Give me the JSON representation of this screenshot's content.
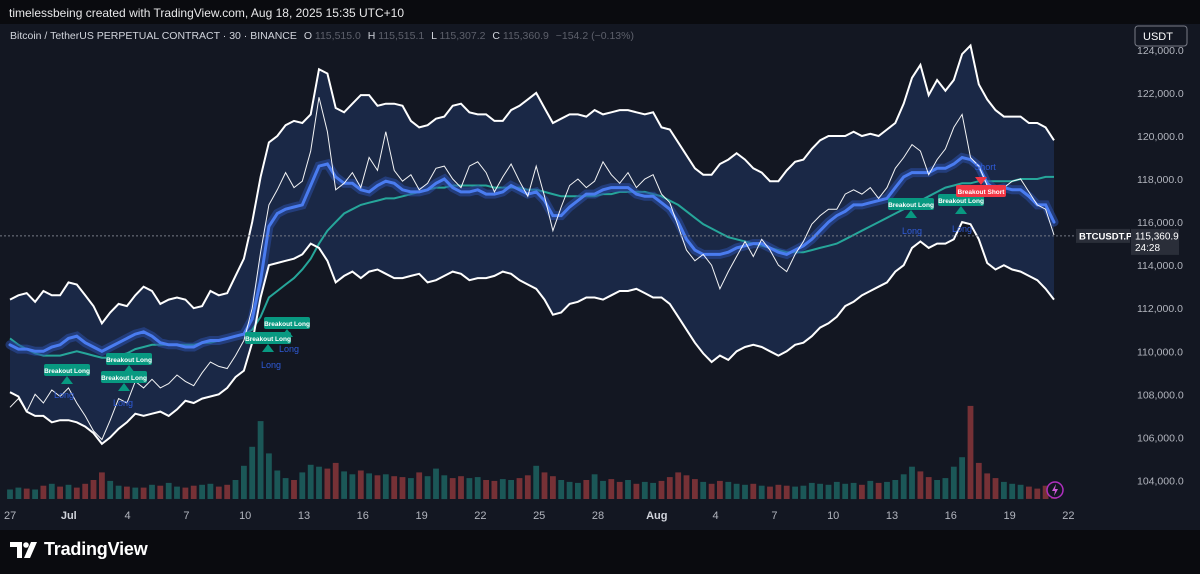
{
  "header": {
    "watermark": "timelessbeing created with TradingView.com, Aug 18, 2025 15:35 UTC+10"
  },
  "legend": {
    "symbol": "Bitcoin / TetherUS PERPETUAL CONTRACT · 30 · BINANCE",
    "o_label": "O",
    "o_value": "115,515.0",
    "h_label": "H",
    "h_value": "115,515.1",
    "l_label": "L",
    "l_value": "115,307.2",
    "c_label": "C",
    "c_value": "115,360.9",
    "change": "−154.2 (−0.13%)"
  },
  "scale": {
    "currency_button": "USDT"
  },
  "price_tag": {
    "ticker": "BTCUSDT.P",
    "price": "115,360.9",
    "countdown": "24:28"
  },
  "signals": [
    {
      "label": "Breakout Long",
      "kind": "long"
    },
    {
      "label": "Breakout Long",
      "kind": "long"
    },
    {
      "label": "Breakout Long",
      "kind": "long"
    },
    {
      "label": "Breakout Long",
      "kind": "long"
    },
    {
      "label": "Breakout Long",
      "kind": "long"
    },
    {
      "label": "Breakout Long",
      "kind": "long"
    },
    {
      "label": "Breakout Long",
      "kind": "long"
    },
    {
      "label": "Breakout Short",
      "kind": "short"
    }
  ],
  "long_markers": [
    "Long",
    "Long",
    "Long",
    "Long",
    "Long",
    "Long"
  ],
  "short_markers": [
    "Short"
  ],
  "footer": {
    "brand": "TradingView"
  },
  "colors": {
    "background": "#131722",
    "band_fill": "#1c2a4a",
    "envelope": "#ffffff",
    "trend_blue": "#4a7cf0",
    "slow_ma": "#26a69a",
    "long_green": "#089981",
    "short_red": "#f23645"
  },
  "chart_data": {
    "type": "line",
    "title": "",
    "ylim": [
      103000,
      125200
    ],
    "y_ticks": [
      104000,
      106000,
      108000,
      110000,
      112000,
      114000,
      116000,
      118000,
      120000,
      122000,
      124000
    ],
    "y_tick_labels": [
      "104,000.0",
      "106,000.0",
      "108,000.0",
      "110,000.0",
      "112,000.0",
      "114,000.0",
      "116,000.0",
      "118,000.0",
      "120,000.0",
      "122,000.0",
      "124,000.0"
    ],
    "x_tick_labels": [
      "27",
      "Jul",
      "4",
      "7",
      "10",
      "13",
      "16",
      "19",
      "22",
      "25",
      "28",
      "Aug",
      "4",
      "7",
      "10",
      "13",
      "16",
      "19",
      "22"
    ],
    "x_tick_bold": [
      false,
      true,
      false,
      false,
      false,
      false,
      false,
      false,
      false,
      false,
      false,
      true,
      false,
      false,
      false,
      false,
      false,
      false,
      false
    ],
    "grid": false,
    "last_price": 115360.9,
    "series": [
      {
        "values": [
          107400,
          107800,
          107200,
          108000,
          107600,
          108200,
          107900,
          108300,
          107600,
          107000,
          106300,
          105900,
          106800,
          107800,
          107600,
          108600,
          108300,
          108700,
          108300,
          108500,
          108900,
          108600,
          108400,
          109000,
          109500,
          109300,
          109200,
          109800,
          110500,
          112000,
          114600,
          116800,
          117500,
          118300,
          117600,
          117900,
          119300,
          121800,
          120200,
          117500,
          117800,
          118300,
          117600,
          119000,
          118400,
          120200,
          118400,
          117900,
          118200,
          117500,
          117800,
          118500,
          118600,
          118000,
          117600,
          118600,
          118800,
          118300,
          117400,
          118100,
          118700,
          117900,
          117200,
          118600,
          117200,
          115600,
          116700,
          117700,
          118000,
          117600,
          117900,
          118800,
          118200,
          117800,
          118300,
          117600,
          118000,
          118200,
          117300,
          116900,
          115800,
          114700,
          114200,
          114500,
          114000,
          112900,
          113700,
          114400,
          115100,
          114400,
          115200,
          114700,
          114000,
          113700,
          114500,
          115100,
          115900,
          116300,
          116600,
          116600,
          117300,
          117500,
          117300,
          117600,
          117100,
          117600,
          118500,
          119000,
          119600,
          119300,
          118200,
          118900,
          119400,
          120400,
          121000,
          119000,
          118600,
          117700,
          117400,
          117600,
          117900,
          118000,
          117400,
          116800,
          116600,
          115400
        ]
      },
      {
        "values": [
          110300,
          110100,
          110100,
          110000,
          110000,
          110200,
          110300,
          110600,
          110700,
          110400,
          110200,
          110000,
          110200,
          110400,
          110600,
          110800,
          110900,
          110700,
          110400,
          110300,
          110300,
          110200,
          110200,
          110400,
          110500,
          110500,
          110600,
          110700,
          110800,
          111500,
          113300,
          115800,
          116400,
          116600,
          116700,
          116800,
          117700,
          118600,
          118700,
          118100,
          117800,
          117800,
          117500,
          117400,
          117700,
          117900,
          117800,
          117500,
          117400,
          117400,
          117500,
          117800,
          118000,
          117600,
          117400,
          117400,
          117500,
          117300,
          117300,
          117400,
          117700,
          117500,
          117300,
          117400,
          117000,
          116300,
          116300,
          116700,
          117000,
          117300,
          117300,
          117500,
          117600,
          117600,
          117600,
          117300,
          117200,
          117200,
          116900,
          116600,
          116000,
          115200,
          114700,
          114500,
          114500,
          114500,
          114600,
          114800,
          114900,
          115000,
          115000,
          114800,
          114600,
          114500,
          114700,
          114900,
          115200,
          115600,
          116000,
          116300,
          116500,
          116800,
          116800,
          116900,
          117000,
          117100,
          117600,
          118100,
          118300,
          118300,
          118300,
          118500,
          118500,
          118700,
          119000,
          118900,
          118600,
          117800,
          117500,
          117600,
          117500,
          117500,
          117200,
          116800,
          116800,
          116000
        ]
      },
      {
        "values": [
          110600,
          110300,
          110100,
          109900,
          109800,
          109800,
          109800,
          109900,
          110000,
          109900,
          109800,
          109700,
          109700,
          109800,
          109900,
          110100,
          110200,
          110300,
          110300,
          110300,
          110300,
          110300,
          110300,
          110400,
          110400,
          110500,
          110600,
          110700,
          110800,
          111000,
          111600,
          112500,
          112800,
          113100,
          113400,
          113800,
          114300,
          115000,
          115600,
          116000,
          116400,
          116600,
          116800,
          116900,
          117000,
          117100,
          117100,
          117200,
          117300,
          117400,
          117500,
          117600,
          117600,
          117700,
          117700,
          117700,
          117700,
          117700,
          117600,
          117600,
          117600,
          117600,
          117500,
          117500,
          117400,
          117300,
          117200,
          117200,
          117200,
          117200,
          117200,
          117300,
          117300,
          117400,
          117400,
          117400,
          117400,
          117300,
          117200,
          117000,
          116800,
          116500,
          116200,
          115900,
          115700,
          115500,
          115300,
          115200,
          115100,
          115000,
          114900,
          114800,
          114700,
          114600,
          114600,
          114600,
          114700,
          114800,
          114900,
          115000,
          115200,
          115400,
          115600,
          115800,
          116000,
          116200,
          116400,
          116600,
          116800,
          117000,
          117200,
          117400,
          117600,
          117700,
          117800,
          117800,
          117900,
          117900,
          117900,
          117900,
          117900,
          118000,
          118000,
          118000,
          118100,
          118100
        ]
      },
      {
        "values": [
          112400,
          112600,
          112700,
          112300,
          112800,
          112600,
          112600,
          113200,
          113100,
          112600,
          112100,
          111300,
          111800,
          112200,
          112100,
          112600,
          113000,
          112800,
          112200,
          112400,
          112500,
          112400,
          112000,
          112100,
          112800,
          112600,
          112700,
          113500,
          114300,
          116000,
          118100,
          119700,
          120000,
          120500,
          120700,
          120600,
          121000,
          123100,
          122900,
          121300,
          121100,
          121500,
          121900,
          121900,
          121400,
          121500,
          121500,
          121400,
          120700,
          120400,
          120500,
          120800,
          120900,
          121400,
          121500,
          121100,
          121000,
          121000,
          120700,
          120700,
          121200,
          121400,
          121700,
          122000,
          121300,
          120600,
          120800,
          121000,
          121000,
          120900,
          121200,
          121000,
          121100,
          121200,
          121200,
          121100,
          121000,
          121100,
          120400,
          120300,
          119700,
          119100,
          118500,
          118200,
          118200,
          118700,
          118900,
          119200,
          118900,
          118500,
          118300,
          117900,
          117900,
          118400,
          118800,
          118900,
          119400,
          119800,
          120000,
          120000,
          120000,
          120200,
          120000,
          120100,
          120000,
          120300,
          120600,
          121500,
          122700,
          123300,
          121900,
          122600,
          122100,
          122600,
          123800,
          124200,
          122400,
          121700,
          121200,
          120900,
          120900,
          120900,
          120600,
          120600,
          120400,
          119800
        ]
      },
      {
        "values": [
          108100,
          107900,
          107200,
          107000,
          107000,
          106700,
          106800,
          106800,
          106700,
          106500,
          106200,
          105700,
          106000,
          106400,
          106700,
          107100,
          107000,
          107100,
          107200,
          107000,
          107300,
          107700,
          107600,
          107800,
          107900,
          108000,
          108300,
          108800,
          109100,
          110400,
          112500,
          114000,
          114100,
          114200,
          114300,
          114500,
          115000,
          114800,
          114200,
          113200,
          113500,
          113700,
          113400,
          113700,
          113800,
          113600,
          113400,
          113400,
          113500,
          113600,
          113200,
          113300,
          113500,
          113700,
          113600,
          113300,
          113400,
          113400,
          113500,
          113700,
          113600,
          113300,
          113100,
          112900,
          112400,
          111700,
          111800,
          112200,
          112300,
          112500,
          112500,
          112400,
          112600,
          112800,
          112800,
          112900,
          112700,
          112500,
          112500,
          112200,
          111600,
          111000,
          110400,
          109900,
          109500,
          109800,
          109600,
          110000,
          110200,
          110300,
          110200,
          110000,
          109800,
          110000,
          110300,
          110400,
          110700,
          111100,
          111300,
          111600,
          112100,
          112300,
          112600,
          112800,
          113000,
          113200,
          113700,
          114000,
          114800,
          115100,
          114800,
          115000,
          115000,
          115200,
          116000,
          115900,
          115200,
          114100,
          113800,
          114000,
          113800,
          113700,
          113500,
          113300,
          112900,
          112400
        ]
      }
    ],
    "volume": [
      0.1,
      0.12,
      0.11,
      0.1,
      0.14,
      0.16,
      0.13,
      0.15,
      0.12,
      0.16,
      0.2,
      0.28,
      0.19,
      0.14,
      0.13,
      0.12,
      0.12,
      0.15,
      0.14,
      0.17,
      0.13,
      0.12,
      0.14,
      0.15,
      0.16,
      0.13,
      0.15,
      0.2,
      0.35,
      0.55,
      0.82,
      0.48,
      0.3,
      0.22,
      0.2,
      0.28,
      0.36,
      0.34,
      0.32,
      0.38,
      0.29,
      0.26,
      0.3,
      0.27,
      0.25,
      0.26,
      0.24,
      0.23,
      0.22,
      0.28,
      0.24,
      0.32,
      0.25,
      0.22,
      0.24,
      0.22,
      0.23,
      0.2,
      0.19,
      0.21,
      0.2,
      0.22,
      0.25,
      0.35,
      0.28,
      0.24,
      0.2,
      0.18,
      0.17,
      0.2,
      0.26,
      0.19,
      0.21,
      0.18,
      0.2,
      0.16,
      0.18,
      0.17,
      0.19,
      0.23,
      0.28,
      0.25,
      0.21,
      0.18,
      0.16,
      0.19,
      0.18,
      0.16,
      0.15,
      0.16,
      0.14,
      0.13,
      0.15,
      0.14,
      0.13,
      0.14,
      0.17,
      0.16,
      0.15,
      0.18,
      0.16,
      0.17,
      0.15,
      0.19,
      0.17,
      0.18,
      0.2,
      0.26,
      0.34,
      0.29,
      0.23,
      0.2,
      0.22,
      0.34,
      0.44,
      0.98,
      0.38,
      0.27,
      0.22,
      0.18,
      0.16,
      0.15,
      0.13,
      0.11,
      0.14,
      0.13
    ]
  }
}
